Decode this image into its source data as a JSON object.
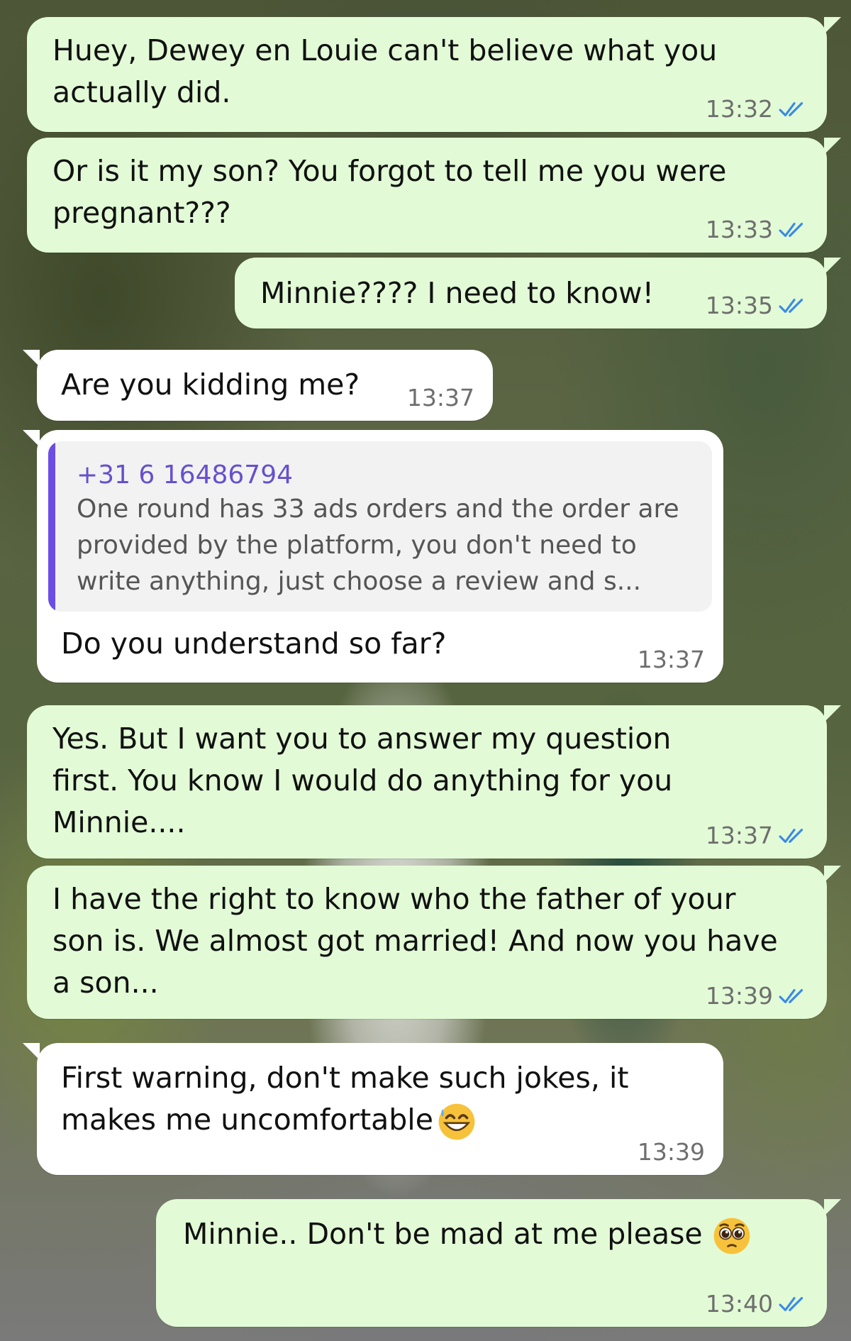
{
  "messages": [
    {
      "direction": "outgoing",
      "text": "Huey, Dewey en Louie can't believe what you actually did.",
      "time": "13:32",
      "status": "read"
    },
    {
      "direction": "outgoing",
      "text": "Or is it my son? You forgot to tell me you were pregnant???",
      "time": "13:33",
      "status": "read"
    },
    {
      "direction": "outgoing",
      "text": "Minnie???? I need to know!",
      "time": "13:35",
      "status": "read"
    },
    {
      "direction": "incoming",
      "text": "Are you kidding me?",
      "time": "13:37"
    },
    {
      "direction": "incoming",
      "quote": {
        "author": "+31 6 16486794",
        "text": "One round has 33 ads orders and the order are provided by the platform, you don't need to write anything, just choose a review and s..."
      },
      "text": "Do you understand so far?",
      "time": "13:37"
    },
    {
      "direction": "outgoing",
      "text": "Yes. But I want you to answer my question first. You know I would do anything for you Minnie....",
      "time": "13:37",
      "status": "read"
    },
    {
      "direction": "outgoing",
      "text": "I have the right to know who the father of your son is. We almost got married! And now you have a son...",
      "time": "13:39",
      "status": "read"
    },
    {
      "direction": "incoming",
      "text": "First warning, don't make such jokes, it makes me uncomfortable",
      "emoji": "grinning-sweat-emoji",
      "time": "13:39"
    },
    {
      "direction": "outgoing",
      "text": "Minnie.. Don't be mad at me please",
      "emoji": "pleading-face-emoji",
      "time": "13:40",
      "status": "read"
    }
  ],
  "colors": {
    "outgoing_bubble": "#e2fbd6",
    "incoming_bubble": "#ffffff",
    "read_ticks": "#3b8ae6",
    "quote_accent": "#6b4de6",
    "timestamp": "#6e6e6e"
  }
}
